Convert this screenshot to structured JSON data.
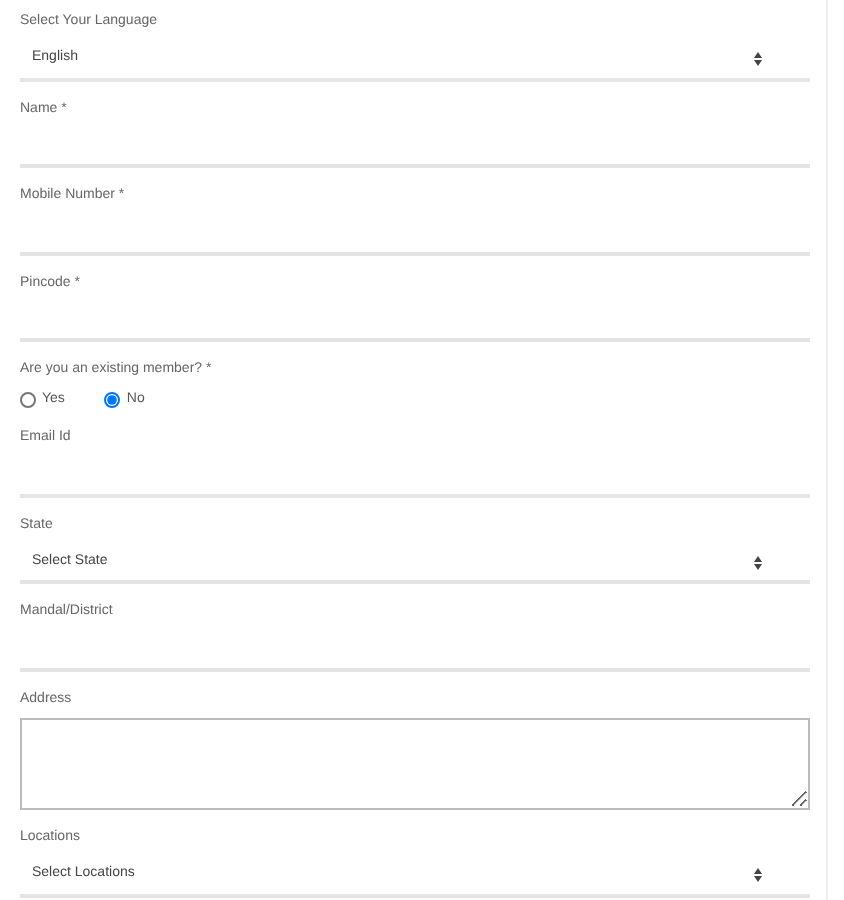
{
  "fields": [
    {
      "kind": "select",
      "label": "Select Your Language",
      "value": "English"
    },
    {
      "kind": "text",
      "label": "Name *"
    },
    {
      "kind": "text",
      "label": "Mobile Number *"
    },
    {
      "kind": "text",
      "label": "Pincode *"
    },
    {
      "kind": "radio",
      "label": "Are you an existing member? *",
      "options": [
        {
          "label": "Yes",
          "selected": false
        },
        {
          "label": "No",
          "selected": true
        }
      ]
    },
    {
      "kind": "text",
      "label": "Email Id"
    },
    {
      "kind": "select",
      "label": "State",
      "value": "Select State"
    },
    {
      "kind": "text",
      "label": "Mandal/District"
    },
    {
      "kind": "textarea",
      "label": "Address"
    },
    {
      "kind": "select",
      "label": "Locations",
      "value": "Select Locations"
    }
  ]
}
